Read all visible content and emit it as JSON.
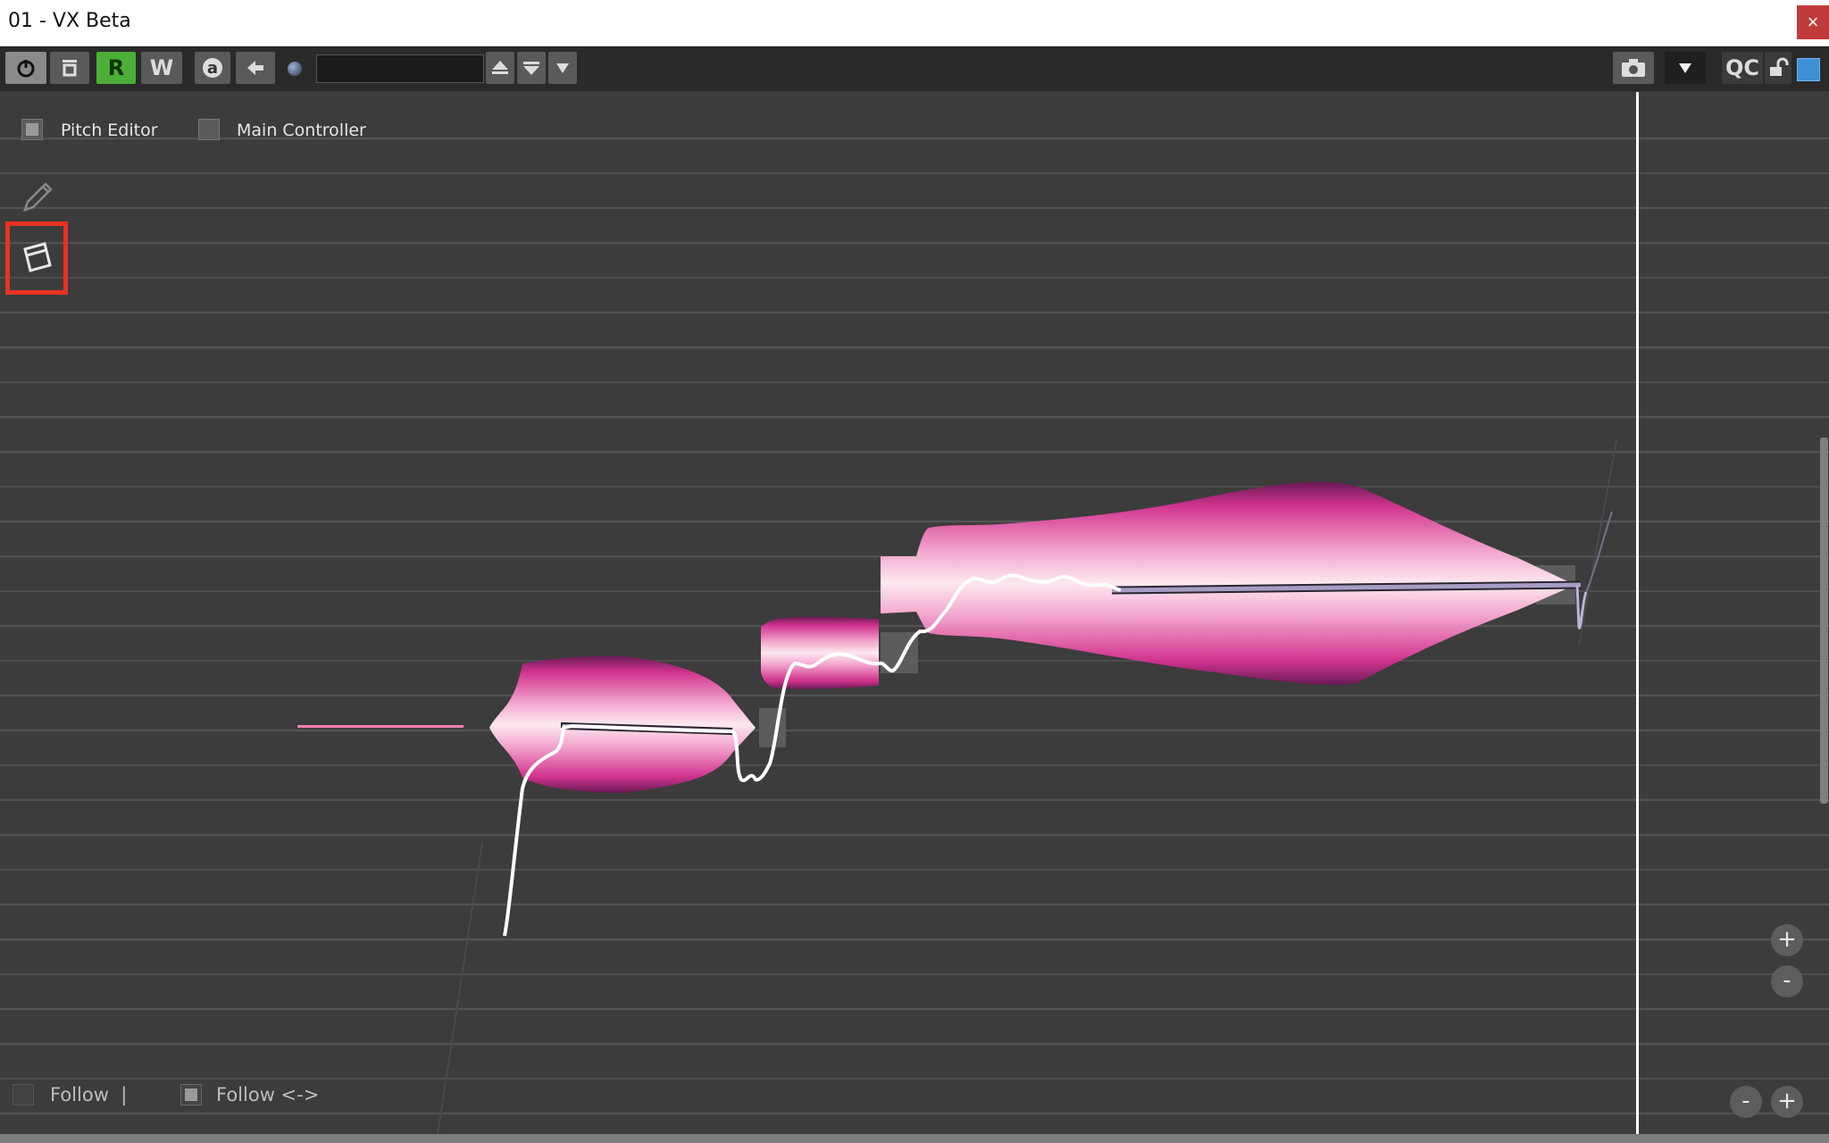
{
  "window": {
    "title": "01 - VX Beta",
    "close_label": "×"
  },
  "toolbar": {
    "power_icon": "power-icon",
    "bypass_icon": "bypass-icon",
    "read_label": "R",
    "write_label": "W",
    "auto_label": "a",
    "back_icon": "arrow-left-icon",
    "preset_value": "",
    "camera_icon": "camera-icon",
    "qc_label": "QC",
    "lock_icon": "unlock-icon",
    "colors": {
      "read_active": "#4caf38",
      "accent_blue": "#3d8fd6"
    }
  },
  "panel": {
    "pitch_editor_label": "Pitch Editor",
    "pitch_editor_checked": true,
    "main_controller_label": "Main Controller",
    "main_controller_checked": false
  },
  "tools": {
    "pencil": "pencil-icon",
    "eraser": "eraser-icon",
    "highlight_color": "#e8331f"
  },
  "zoom": {
    "vertical_plus": "+",
    "vertical_minus": "-",
    "horizontal_minus": "-",
    "horizontal_plus": "+"
  },
  "footer": {
    "follow_label": "Follow  |",
    "follow_checked": false,
    "follow2_label": "Follow <->",
    "follow2_checked": true
  }
}
